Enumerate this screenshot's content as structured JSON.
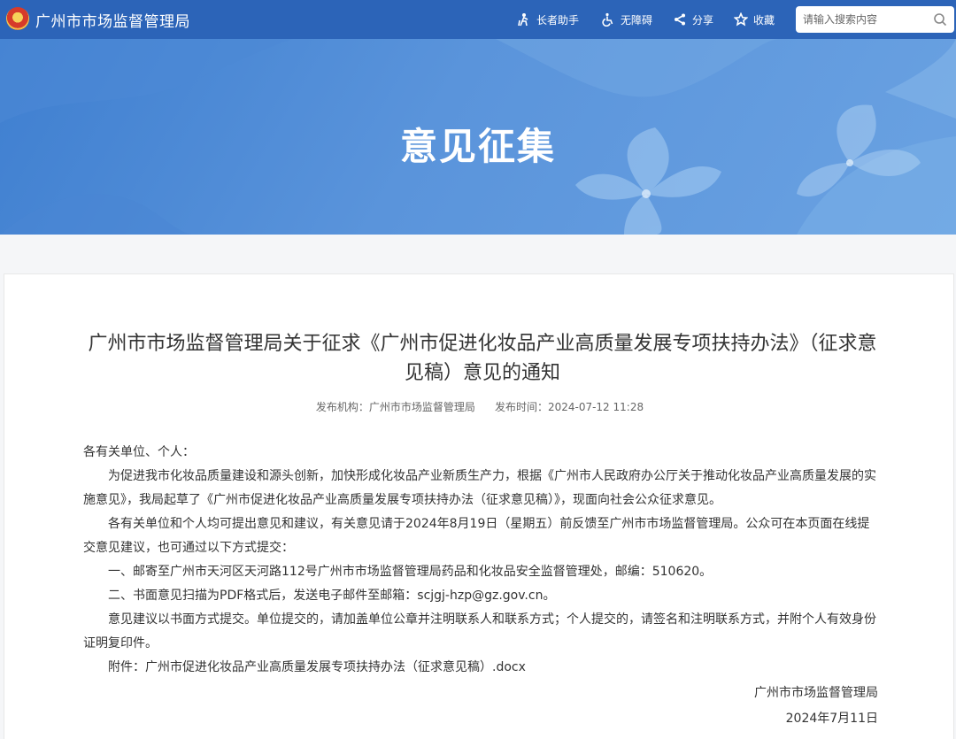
{
  "header": {
    "site_title": "广州市市场监督管理局",
    "tools": {
      "elder": "长者助手",
      "accessibility": "无障碍",
      "share": "分享",
      "favorite": "收藏"
    },
    "search": {
      "placeholder": "请输入搜索内容",
      "value": ""
    }
  },
  "banner": {
    "title": "意见征集"
  },
  "article": {
    "title": "广州市市场监督管理局关于征求《广州市促进化妆品产业高质量发展专项扶持办法》（征求意见稿）意见的通知",
    "publisher_label": "发布机构：",
    "publisher": "广州市市场监督管理局",
    "time_label": "发布时间：",
    "time": "2024-07-12 11:28",
    "salutation": "各有关单位、个人：",
    "paragraphs": [
      "为促进我市化妆品质量建设和源头创新，加快形成化妆品产业新质生产力，根据《广州市人民政府办公厅关于推动化妆品产业高质量发展的实施意见》，我局起草了《广州市促进化妆品产业高质量发展专项扶持办法（征求意见稿）》，现面向社会公众征求意见。",
      "各有关单位和个人均可提出意见和建议，有关意见请于2024年8月19日（星期五）前反馈至广州市市场监督管理局。公众可在本页面在线提交意见建议，也可通过以下方式提交：",
      "一、邮寄至广州市天河区天河路112号广州市市场监督管理局药品和化妆品安全监督管理处，邮编：510620。",
      "二、书面意见扫描为PDF格式后，发送电子邮件至邮箱：scjgj-hzp@gz.gov.cn。",
      "意见建议以书面方式提交。单位提交的，请加盖单位公章并注明联系人和联系方式；个人提交的，请签名和注明联系方式，并附个人有效身份证明复印件。"
    ],
    "attachment_label": "附件：",
    "attachment": "广州市促进化妆品产业高质量发展专项扶持办法（征求意见稿）.docx",
    "signature": "广州市市场监督管理局",
    "date": "2024年7月11日"
  },
  "colors": {
    "topbar": "#2c64b8",
    "banner": "#5a94db",
    "text": "#333333"
  }
}
